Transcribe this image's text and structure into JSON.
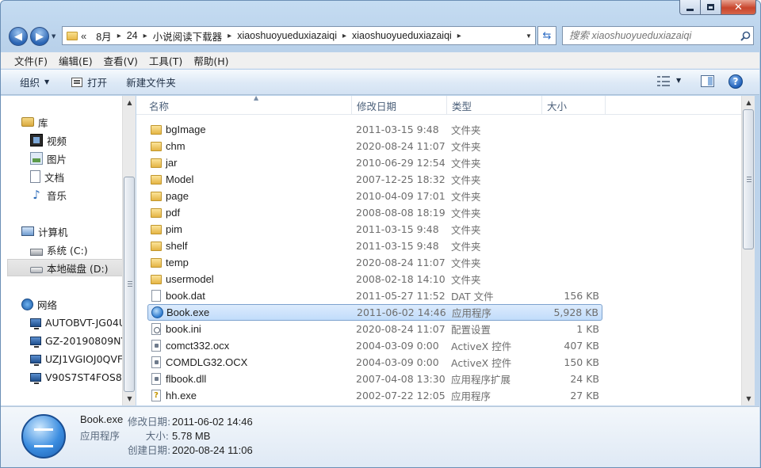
{
  "window": {
    "min_label": "",
    "max_label": "",
    "close_glyph": "✕"
  },
  "address": {
    "overflow": "«",
    "segments": [
      "8月",
      "24",
      "小说阅读下载器",
      "xiaoshuoyueduxiazaiqi",
      "xiaoshuoyueduxiazaiqi"
    ],
    "separator": "▸"
  },
  "search": {
    "placeholder": "搜索 xiaoshuoyueduxiazaiqi"
  },
  "menu": [
    "文件(F)",
    "编辑(E)",
    "查看(V)",
    "工具(T)",
    "帮助(H)"
  ],
  "commands": {
    "organize": "组织",
    "open": "打开",
    "new_folder": "新建文件夹"
  },
  "nav": {
    "library": "库",
    "video": "视频",
    "pictures": "图片",
    "documents": "文档",
    "music": "音乐",
    "computer": "计算机",
    "drive_c": "系统 (C:)",
    "drive_d": "本地磁盘 (D:)",
    "network": "网络",
    "pcs": [
      "AUTOBVT-JG04U",
      "GZ-20190809NY",
      "UZJ1VGIOJ0QVF",
      "V90S7ST4FOS8C"
    ]
  },
  "columns": {
    "name": "名称",
    "date": "修改日期",
    "type": "类型",
    "size": "大小"
  },
  "files": [
    {
      "name": "bgImage",
      "date": "2011-03-15 9:48",
      "type": "文件夹",
      "size": "",
      "icon": "folder"
    },
    {
      "name": "chm",
      "date": "2020-08-24 11:07",
      "type": "文件夹",
      "size": "",
      "icon": "folder"
    },
    {
      "name": "jar",
      "date": "2010-06-29 12:54",
      "type": "文件夹",
      "size": "",
      "icon": "folder"
    },
    {
      "name": "Model",
      "date": "2007-12-25 18:32",
      "type": "文件夹",
      "size": "",
      "icon": "folder"
    },
    {
      "name": "page",
      "date": "2010-04-09 17:01",
      "type": "文件夹",
      "size": "",
      "icon": "folder"
    },
    {
      "name": "pdf",
      "date": "2008-08-08 18:19",
      "type": "文件夹",
      "size": "",
      "icon": "folder"
    },
    {
      "name": "pim",
      "date": "2011-03-15 9:48",
      "type": "文件夹",
      "size": "",
      "icon": "folder"
    },
    {
      "name": "shelf",
      "date": "2011-03-15 9:48",
      "type": "文件夹",
      "size": "",
      "icon": "folder"
    },
    {
      "name": "temp",
      "date": "2020-08-24 11:07",
      "type": "文件夹",
      "size": "",
      "icon": "folder"
    },
    {
      "name": "usermodel",
      "date": "2008-02-18 14:10",
      "type": "文件夹",
      "size": "",
      "icon": "folder"
    },
    {
      "name": "book.dat",
      "date": "2011-05-27 11:52",
      "type": "DAT 文件",
      "size": "156 KB",
      "icon": "file"
    },
    {
      "name": "Book.exe",
      "date": "2011-06-02 14:46",
      "type": "应用程序",
      "size": "5,928 KB",
      "icon": "exe"
    },
    {
      "name": "book.ini",
      "date": "2020-08-24 11:07",
      "type": "配置设置",
      "size": "1 KB",
      "icon": "config"
    },
    {
      "name": "comct332.ocx",
      "date": "2004-03-09 0:00",
      "type": "ActiveX 控件",
      "size": "407 KB",
      "icon": "dll"
    },
    {
      "name": "COMDLG32.OCX",
      "date": "2004-03-09 0:00",
      "type": "ActiveX 控件",
      "size": "150 KB",
      "icon": "dll"
    },
    {
      "name": "flbook.dll",
      "date": "2007-04-08 13:30",
      "type": "应用程序扩展",
      "size": "24 KB",
      "icon": "dll"
    },
    {
      "name": "hh.exe",
      "date": "2002-07-22 12:05",
      "type": "应用程序",
      "size": "27 KB",
      "icon": "help"
    }
  ],
  "selected_index": 11,
  "details": {
    "name": "Book.exe",
    "type": "应用程序",
    "modified_label": "修改日期:",
    "modified_value": "2011-06-02 14:46",
    "size_label": "大小:",
    "size_value": "5.78 MB",
    "created_label": "创建日期:",
    "created_value": "2020-08-24 11:06"
  }
}
